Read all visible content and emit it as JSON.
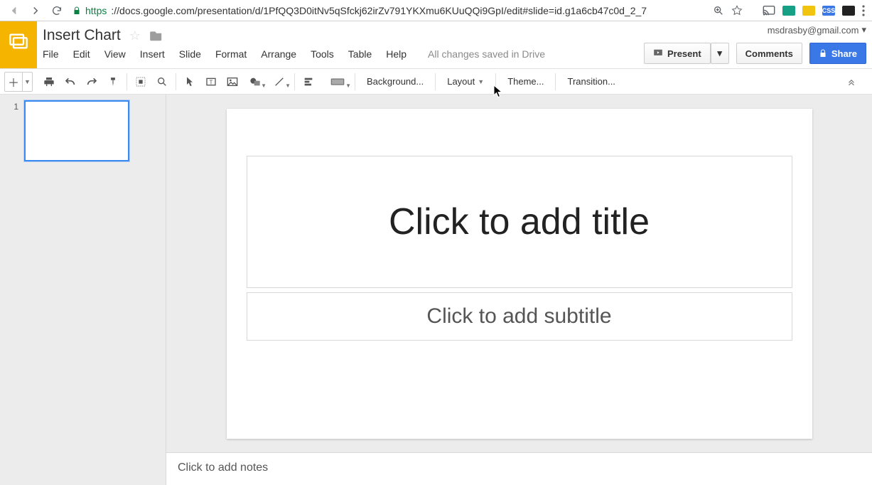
{
  "browser": {
    "url_proto": "https",
    "url_rest": "://docs.google.com/presentation/d/1PfQQ3D0itNv5qSfckj62irZv791YKXmu6KUuQQi9GpI/edit#slide=id.g1a6cb47c0d_2_7",
    "css_badge": "CSS"
  },
  "header": {
    "doc_title": "Insert Chart",
    "email": "msdrasby@gmail.com",
    "present_label": "Present",
    "comments_label": "Comments",
    "share_label": "Share",
    "save_status": "All changes saved in Drive"
  },
  "menu": {
    "items": [
      "File",
      "Edit",
      "View",
      "Insert",
      "Slide",
      "Format",
      "Arrange",
      "Tools",
      "Table",
      "Help"
    ]
  },
  "toolbar": {
    "background": "Background...",
    "layout": "Layout",
    "theme": "Theme...",
    "transition": "Transition..."
  },
  "thumbs": {
    "first_index": "1"
  },
  "slide": {
    "title_placeholder": "Click to add title",
    "subtitle_placeholder": "Click to add subtitle"
  },
  "notes": {
    "placeholder": "Click to add notes"
  }
}
